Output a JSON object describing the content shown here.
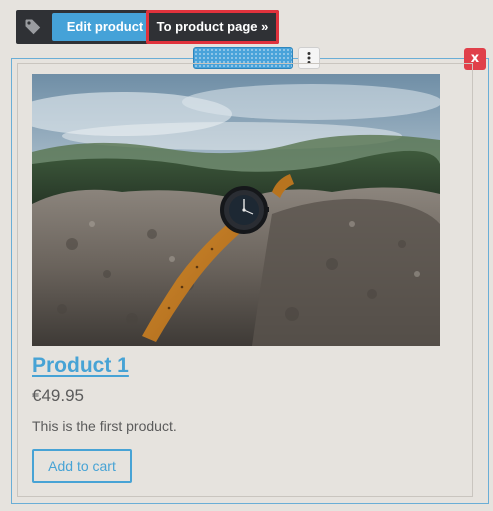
{
  "toolbar": {
    "icon": "tag-icon",
    "edit_label": "Edit product",
    "product_page_label": "To product page »"
  },
  "block": {
    "close_label": "x",
    "menu_icon": "vertical-dots-icon",
    "handle_icon": "drag-handle"
  },
  "product": {
    "title": "Product 1",
    "price": "€49.95",
    "description": "This is the first product.",
    "add_to_cart_label": "Add to cart"
  },
  "colors": {
    "accent": "#47a3d5",
    "toolbar_bg": "#2f3135",
    "highlight": "#e0323c",
    "close": "#e0404a",
    "page_bg": "#e6e3de"
  }
}
